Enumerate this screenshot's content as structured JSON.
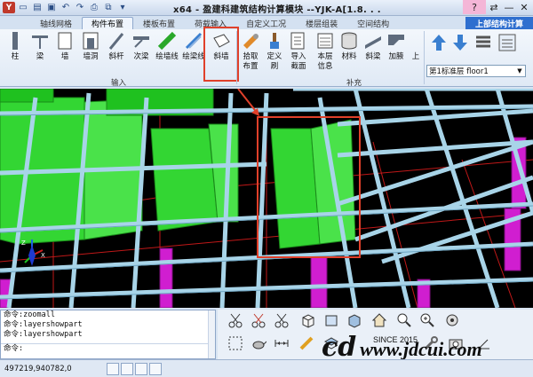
{
  "app": {
    "title": "x64 - 盈建科建筑结构计算模块 --YJK-A[1.8. . .",
    "logo": "Y"
  },
  "tabs": [
    "轴线网格",
    "构件布置",
    "楼板布置",
    "荷载输入",
    "自定义工况",
    "楼层组装",
    "空间结构",
    "上部结构计算"
  ],
  "active_tab": "构件布置",
  "ribbon": {
    "input_group": {
      "label": "输入",
      "buttons": [
        "柱",
        "梁",
        "墙",
        "墙洞",
        "斜杆",
        "次梁",
        "绘墙线",
        "绘梁线",
        "斜墙"
      ],
      "highlighted": "斜墙"
    },
    "supplement_group": {
      "label": "补充",
      "buttons": [
        {
          "line1": "拾取",
          "line2": "布置"
        },
        {
          "line1": "定义",
          "line2": "刷"
        },
        {
          "line1": "导入",
          "line2": "截面"
        },
        {
          "line1": "本层",
          "line2": "信息"
        },
        {
          "line1": "材料",
          "line2": ""
        },
        {
          "line1": "斜梁",
          "line2": ""
        },
        {
          "line1": "加腋",
          "line2": ""
        },
        {
          "line1": "上",
          "line2": ""
        }
      ]
    },
    "floor_select": "第1标准层 floor1"
  },
  "command_lines": [
    "命令:zoomall",
    "命令:layershowpart",
    "命令:layershowpart",
    "命令:"
  ],
  "status": {
    "coords": "497219,940782,0"
  },
  "watermark": {
    "logo": "cd",
    "since": "SINCE 2015",
    "url": "www.jdcui.com"
  },
  "colors": {
    "accent": "#2f6fcf",
    "highlight_box": "#e0402a",
    "wall_green": "#33d633",
    "beam_cyan": "#a8d4e8",
    "column_magenta": "#d01ed0"
  },
  "icons": [
    "save-icon",
    "open-icon",
    "undo-icon",
    "redo-icon",
    "print-icon"
  ]
}
